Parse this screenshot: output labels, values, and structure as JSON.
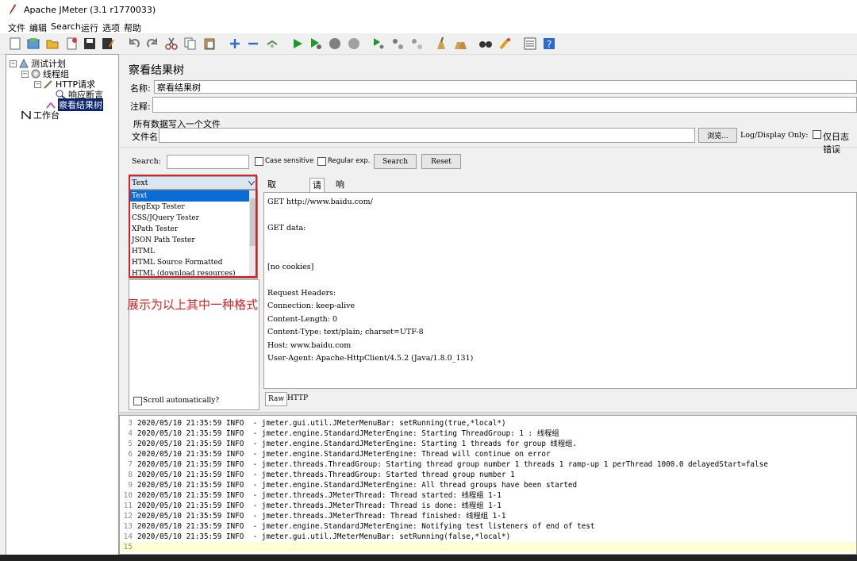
{
  "window": {
    "title": "Apache JMeter (3.1 r1770033)"
  },
  "menu": [
    "文件",
    "编辑",
    "Search",
    "运行",
    "选项",
    "帮助"
  ],
  "tree": {
    "test_plan": "测试计划",
    "thread_group": "线程组",
    "http_request": "HTTP请求",
    "response_assertion": "响应断言",
    "view_results_tree": "察看结果树",
    "workbench": "工作台"
  },
  "panel": {
    "title": "察看结果树",
    "name_label": "名称:",
    "name_value": "察看结果树",
    "comment_label": "注释:",
    "comment_value": "",
    "write_all_label": "所有数据写入一个文件",
    "filename_label": "文件名",
    "filename_value": "",
    "browse_label": "浏览...",
    "log_display_label": "Log/Display Only:",
    "errors_only_label": "仅日志错误"
  },
  "search": {
    "label": "Search:",
    "value": "",
    "case_sensitive": "Case sensitive",
    "regular_exp": "Regular exp.",
    "search_button": "Search",
    "reset_button": "Reset"
  },
  "renderer": {
    "selected": "Text",
    "options": [
      "Text",
      "RegExp Tester",
      "CSS/JQuery Tester",
      "XPath Tester",
      "JSON Path Tester",
      "HTML",
      "HTML Source Formatted",
      "HTML (download resources)"
    ],
    "annotation": "展示为以上其中一种格式",
    "scroll_auto": "Scroll automatically?"
  },
  "result_tabs": {
    "sampler_result": "取样器结果",
    "request": "请求",
    "response_data": "响应数据"
  },
  "request_lines": [
    "GET http://www.baidu.com/",
    "",
    "GET data:",
    "",
    "",
    "[no cookies]",
    "",
    "Request Headers:",
    "Connection: keep-alive",
    "Content-Length: 0",
    "Content-Type: text/plain; charset=UTF-8",
    "Host: www.baidu.com",
    "User-Agent: Apache-HttpClient/4.5.2 (Java/1.8.0_131)"
  ],
  "bottom_tabs": {
    "raw": "Raw",
    "http": "HTTP"
  },
  "log_lines": [
    {
      "n": "3",
      "text": "2020/05/10 21:35:59 INFO  - jmeter.gui.util.JMeterMenuBar: setRunning(true,*local*)"
    },
    {
      "n": "4",
      "text": "2020/05/10 21:35:59 INFO  - jmeter.engine.StandardJMeterEngine: Starting ThreadGroup: 1 : 线程组"
    },
    {
      "n": "5",
      "text": "2020/05/10 21:35:59 INFO  - jmeter.engine.StandardJMeterEngine: Starting 1 threads for group 线程组."
    },
    {
      "n": "6",
      "text": "2020/05/10 21:35:59 INFO  - jmeter.engine.StandardJMeterEngine: Thread will continue on error"
    },
    {
      "n": "7",
      "text": "2020/05/10 21:35:59 INFO  - jmeter.threads.ThreadGroup: Starting thread group number 1 threads 1 ramp-up 1 perThread 1000.0 delayedStart=false"
    },
    {
      "n": "8",
      "text": "2020/05/10 21:35:59 INFO  - jmeter.threads.ThreadGroup: Started thread group number 1"
    },
    {
      "n": "9",
      "text": "2020/05/10 21:35:59 INFO  - jmeter.engine.StandardJMeterEngine: All thread groups have been started"
    },
    {
      "n": "10",
      "text": "2020/05/10 21:35:59 INFO  - jmeter.threads.JMeterThread: Thread started: 线程组 1-1"
    },
    {
      "n": "11",
      "text": "2020/05/10 21:35:59 INFO  - jmeter.threads.JMeterThread: Thread is done: 线程组 1-1"
    },
    {
      "n": "12",
      "text": "2020/05/10 21:35:59 INFO  - jmeter.threads.JMeterThread: Thread finished: 线程组 1-1"
    },
    {
      "n": "13",
      "text": "2020/05/10 21:35:59 INFO  - jmeter.engine.StandardJMeterEngine: Notifying test listeners of end of test"
    },
    {
      "n": "14",
      "text": "2020/05/10 21:35:59 INFO  - jmeter.gui.util.JMeterMenuBar: setRunning(false,*local*)"
    },
    {
      "n": "15",
      "text": ""
    }
  ],
  "colors": {
    "selection": "#0a246a",
    "annotation_red": "#e02020",
    "log_highlight": "#ffffd6"
  }
}
